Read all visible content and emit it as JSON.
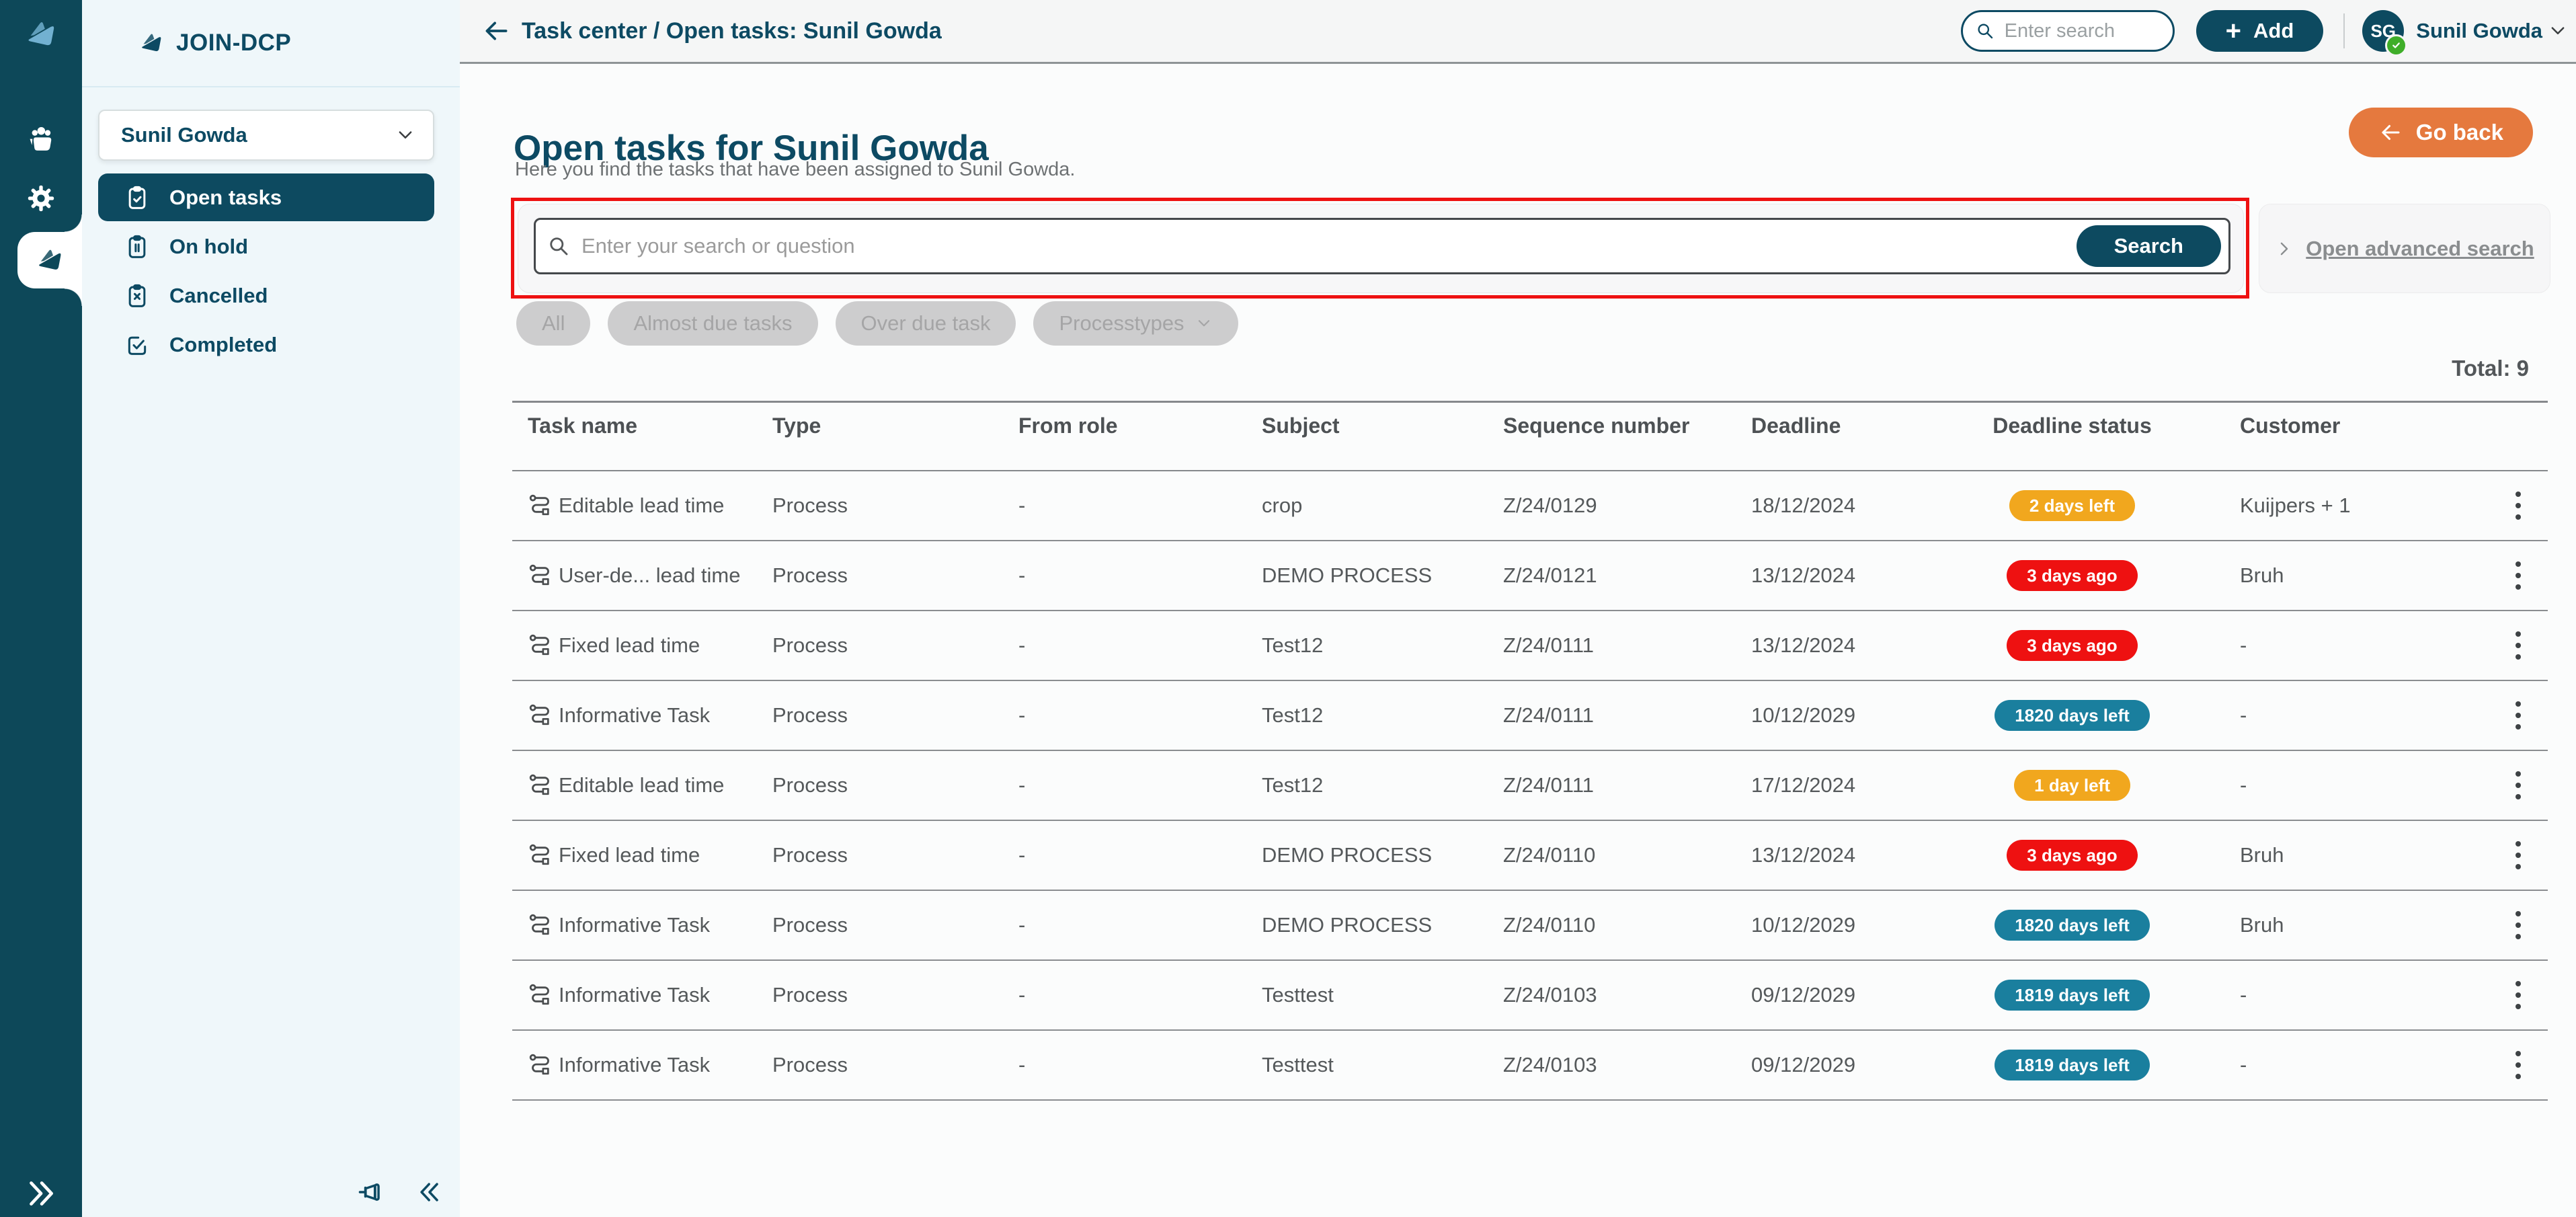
{
  "colors": {
    "navy": "#0d4a63",
    "rail_background": "#0d4859",
    "panel_background": "#eff7fa",
    "status_amber": "#f1a71e",
    "status_red": "#ee1111",
    "status_teal": "#1a7f9e",
    "go_back_orange": "#e5793e",
    "annotation_red": "#ee1111",
    "presence_green": "#3fae29"
  },
  "sidebar": {
    "brand": "JOIN-DCP",
    "workspace": "Sunil Gowda",
    "items": [
      {
        "label": "Open tasks",
        "icon": "clipboard-check",
        "active": true
      },
      {
        "label": "On hold",
        "icon": "clipboard-pause",
        "active": false
      },
      {
        "label": "Cancelled",
        "icon": "clipboard-x",
        "active": false
      },
      {
        "label": "Completed",
        "icon": "check-square",
        "active": false
      }
    ]
  },
  "topbar": {
    "title": "Task center / Open tasks: Sunil Gowda",
    "search_placeholder": "Enter search",
    "add_plus": "+",
    "add_label": "Add",
    "user": {
      "initials": "SG",
      "name": "Sunil Gowda"
    }
  },
  "main": {
    "heading": "Open tasks for Sunil Gowda",
    "subtitle": "Here you find the tasks that have been assigned to Sunil Gowda.",
    "go_back_label": "Go back",
    "search": {
      "placeholder": "Enter your search or question",
      "button_label": "Search",
      "advanced_label": "Open advanced search"
    },
    "filters": [
      {
        "label": "All",
        "has_chevron": false
      },
      {
        "label": "Almost due tasks",
        "has_chevron": false
      },
      {
        "label": "Over due task",
        "has_chevron": false
      },
      {
        "label": "Processtypes",
        "has_chevron": true
      }
    ],
    "total_label": "Total: 9",
    "table": {
      "columns": [
        "Task name",
        "Type",
        "From role",
        "Subject",
        "Sequence number",
        "Deadline",
        "Deadline status",
        "Customer"
      ],
      "rows": [
        {
          "task": "Editable lead time",
          "type": "Process",
          "from_role": "-",
          "subject": "crop",
          "sequence": "Z/24/0129",
          "deadline": "18/12/2024",
          "status": "2 days left",
          "status_color": "amber",
          "customer": "Kuijpers + 1"
        },
        {
          "task": "User-de... lead time",
          "type": "Process",
          "from_role": "-",
          "subject": "DEMO PROCESS",
          "sequence": "Z/24/0121",
          "deadline": "13/12/2024",
          "status": "3 days ago",
          "status_color": "red",
          "customer": "Bruh"
        },
        {
          "task": "Fixed lead time",
          "type": "Process",
          "from_role": "-",
          "subject": "Test12",
          "sequence": "Z/24/0111",
          "deadline": "13/12/2024",
          "status": "3 days ago",
          "status_color": "red",
          "customer": "-"
        },
        {
          "task": "Informative Task",
          "type": "Process",
          "from_role": "-",
          "subject": "Test12",
          "sequence": "Z/24/0111",
          "deadline": "10/12/2029",
          "status": "1820 days left",
          "status_color": "teal",
          "customer": "-"
        },
        {
          "task": "Editable lead time",
          "type": "Process",
          "from_role": "-",
          "subject": "Test12",
          "sequence": "Z/24/0111",
          "deadline": "17/12/2024",
          "status": "1 day left",
          "status_color": "amber",
          "customer": "-"
        },
        {
          "task": "Fixed lead time",
          "type": "Process",
          "from_role": "-",
          "subject": "DEMO PROCESS",
          "sequence": "Z/24/0110",
          "deadline": "13/12/2024",
          "status": "3 days ago",
          "status_color": "red",
          "customer": "Bruh"
        },
        {
          "task": "Informative Task",
          "type": "Process",
          "from_role": "-",
          "subject": "DEMO PROCESS",
          "sequence": "Z/24/0110",
          "deadline": "10/12/2029",
          "status": "1820 days left",
          "status_color": "teal",
          "customer": "Bruh"
        },
        {
          "task": "Informative Task",
          "type": "Process",
          "from_role": "-",
          "subject": "Testtest",
          "sequence": "Z/24/0103",
          "deadline": "09/12/2029",
          "status": "1819 days left",
          "status_color": "teal",
          "customer": "-"
        },
        {
          "task": "Informative Task",
          "type": "Process",
          "from_role": "-",
          "subject": "Testtest",
          "sequence": "Z/24/0103",
          "deadline": "09/12/2029",
          "status": "1819 days left",
          "status_color": "teal",
          "customer": "-"
        }
      ]
    }
  }
}
